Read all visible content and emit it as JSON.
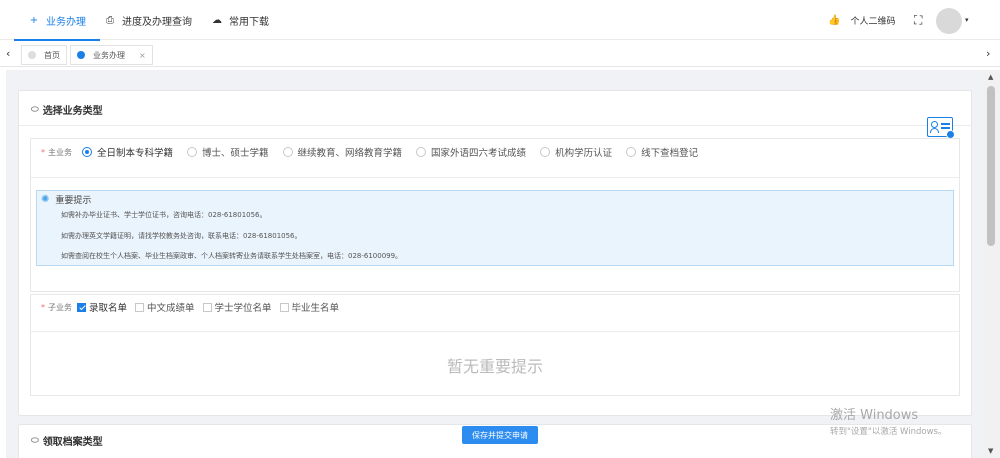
{
  "topnav": {
    "tabs": [
      {
        "label": "业务办理",
        "icon": "plus-icon",
        "glyph": "+"
      },
      {
        "label": "进度及办理查询",
        "icon": "printer-icon",
        "glyph": "⎙"
      },
      {
        "label": "常用下载",
        "icon": "cloud-download-icon",
        "glyph": "☁"
      }
    ],
    "qrcode_label": "个人二维码",
    "thumb_glyph": "👍",
    "fullscreen_glyph": "⛶",
    "caret_glyph": "▾"
  },
  "tabsbar": {
    "left_arrow": "‹",
    "right_arrow": "›",
    "home_label": "首页",
    "active_label": "业务办理",
    "close_glyph": "×"
  },
  "section1": {
    "title": "选择业务类型",
    "main_label": "主业务",
    "main_options": [
      "全日制本专科学籍",
      "博士、硕士学籍",
      "继续教育、网络教育学籍",
      "国家外语四六考试成绩",
      "机构学历认证",
      "线下查档登记"
    ],
    "tip_title": "重要提示",
    "tip_lines": [
      "如需补办毕业证书、学士学位证书，咨询电话：028-61801056。",
      "如需办理英文学籍证明，请找学校教务处咨询，联系电话：028-61801056。",
      "如需查阅在校生个人档案、毕业生档案政审、个人档案转寄业务请联系学生处档案室，电话：028-6100099。"
    ],
    "sub_label": "子业务",
    "sub_options": [
      "录取名单",
      "中文成绩单",
      "学士学位名单",
      "毕业生名单"
    ],
    "empty_text": "暂无重要提示"
  },
  "section2": {
    "title": "领取档案类型"
  },
  "submit_label": "保存并提交申请",
  "watermark": {
    "line1": "激活 Windows",
    "line2": "转到\"设置\"以激活 Windows。"
  },
  "colors": {
    "accent": "#1a7fe6",
    "button": "#2d8cf0",
    "required": "#f56c6c",
    "tip_bg": "#eaf4fc"
  }
}
